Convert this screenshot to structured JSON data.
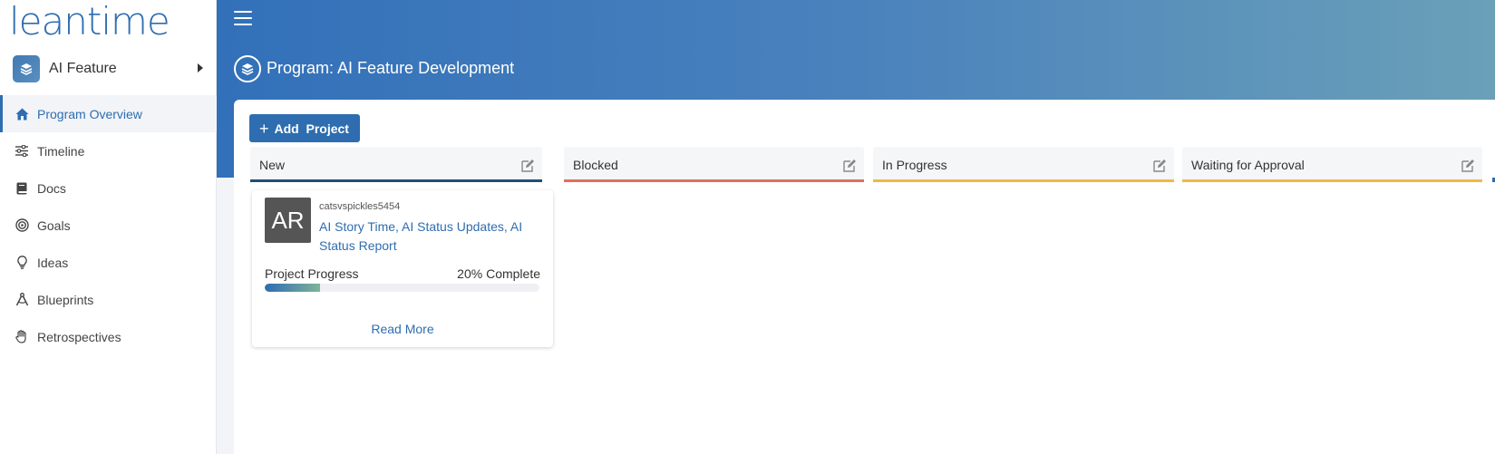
{
  "app": {
    "logo_text": "leantime"
  },
  "project_switcher": {
    "name": "AI Feature"
  },
  "sidebar": {
    "items": [
      {
        "label": "Program Overview",
        "icon": "home-icon",
        "active": true
      },
      {
        "label": "Timeline",
        "icon": "sliders-icon",
        "active": false
      },
      {
        "label": "Docs",
        "icon": "book-icon",
        "active": false
      },
      {
        "label": "Goals",
        "icon": "target-icon",
        "active": false
      },
      {
        "label": "Ideas",
        "icon": "lightbulb-icon",
        "active": false
      },
      {
        "label": "Blueprints",
        "icon": "compass-icon",
        "active": false
      },
      {
        "label": "Retrospectives",
        "icon": "hand-icon",
        "active": false
      }
    ]
  },
  "header": {
    "title": "Program: AI Feature Development"
  },
  "toolbar": {
    "add_project_label": "Add  Project"
  },
  "columns": [
    {
      "title": "New",
      "color": "#1f4e79"
    },
    {
      "title": "Blocked",
      "color": "#e0705c"
    },
    {
      "title": "In Progress",
      "color": "#f0b84a"
    },
    {
      "title": "Waiting for Approval",
      "color": "#f0b84a"
    }
  ],
  "card": {
    "avatar_initials": "AR",
    "user": "catsvspickles5454",
    "title": "AI Story Time, AI Status Updates, AI Status Report",
    "progress_label": "Project Progress",
    "progress_complete": "20% Complete",
    "progress_value": 0.2,
    "read_more": "Read More"
  },
  "colors": {
    "accent": "#2e6db0",
    "header_start": "#3270b9",
    "header_end": "#6aa0b8"
  }
}
